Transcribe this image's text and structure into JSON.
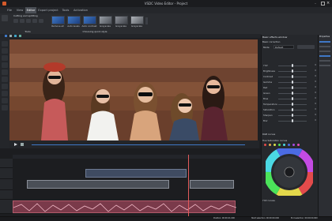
{
  "window": {
    "title": "VSDC Video Editor - Project"
  },
  "menu": {
    "tabs": [
      "File",
      "View",
      "Editor",
      "Export project",
      "Tools",
      "Activation"
    ],
    "active_index": 2
  },
  "ribbon": {
    "cut_label": "Cutting and splitting",
    "tools_label": "Tools",
    "choosing_label": "Choosing quick style",
    "effects": [
      "Remove all",
      "Auto levels",
      "Auto contrast",
      "Grayscale",
      "Grayscale",
      "Grayscale"
    ]
  },
  "color_panel": {
    "title": "Basic effects window",
    "section_basic": "Basic correction",
    "preset_label": "Mode",
    "preset_value": "Default",
    "sliders": [
      {
        "label": "YUV",
        "value": "0"
      },
      {
        "label": "Brightness",
        "value": "0"
      },
      {
        "label": "Contrast",
        "value": "0"
      },
      {
        "label": "Gamma",
        "value": "0"
      },
      {
        "label": "Red",
        "value": "0"
      },
      {
        "label": "Green",
        "value": "0"
      },
      {
        "label": "Blue",
        "value": "0"
      },
      {
        "label": "Temperature",
        "value": "0"
      },
      {
        "label": "Saturation",
        "value": "0"
      },
      {
        "label": "Sharpen",
        "value": "0"
      },
      {
        "label": "Blur",
        "value": "0"
      }
    ],
    "section_rgb": "RGB curves",
    "section_hue": "Hue Saturation curves",
    "section_yuv": "YUV curves"
  },
  "properties_panel": {
    "title": "Properties"
  },
  "status": {
    "position": "Position: 00:00:21.000",
    "start": "Start selection: 00:00:00.000",
    "end": "End selection: 00:00:00.000"
  },
  "colors": {
    "accent": "#3f78c6",
    "panel": "#26282c",
    "background": "#1e1f22"
  }
}
